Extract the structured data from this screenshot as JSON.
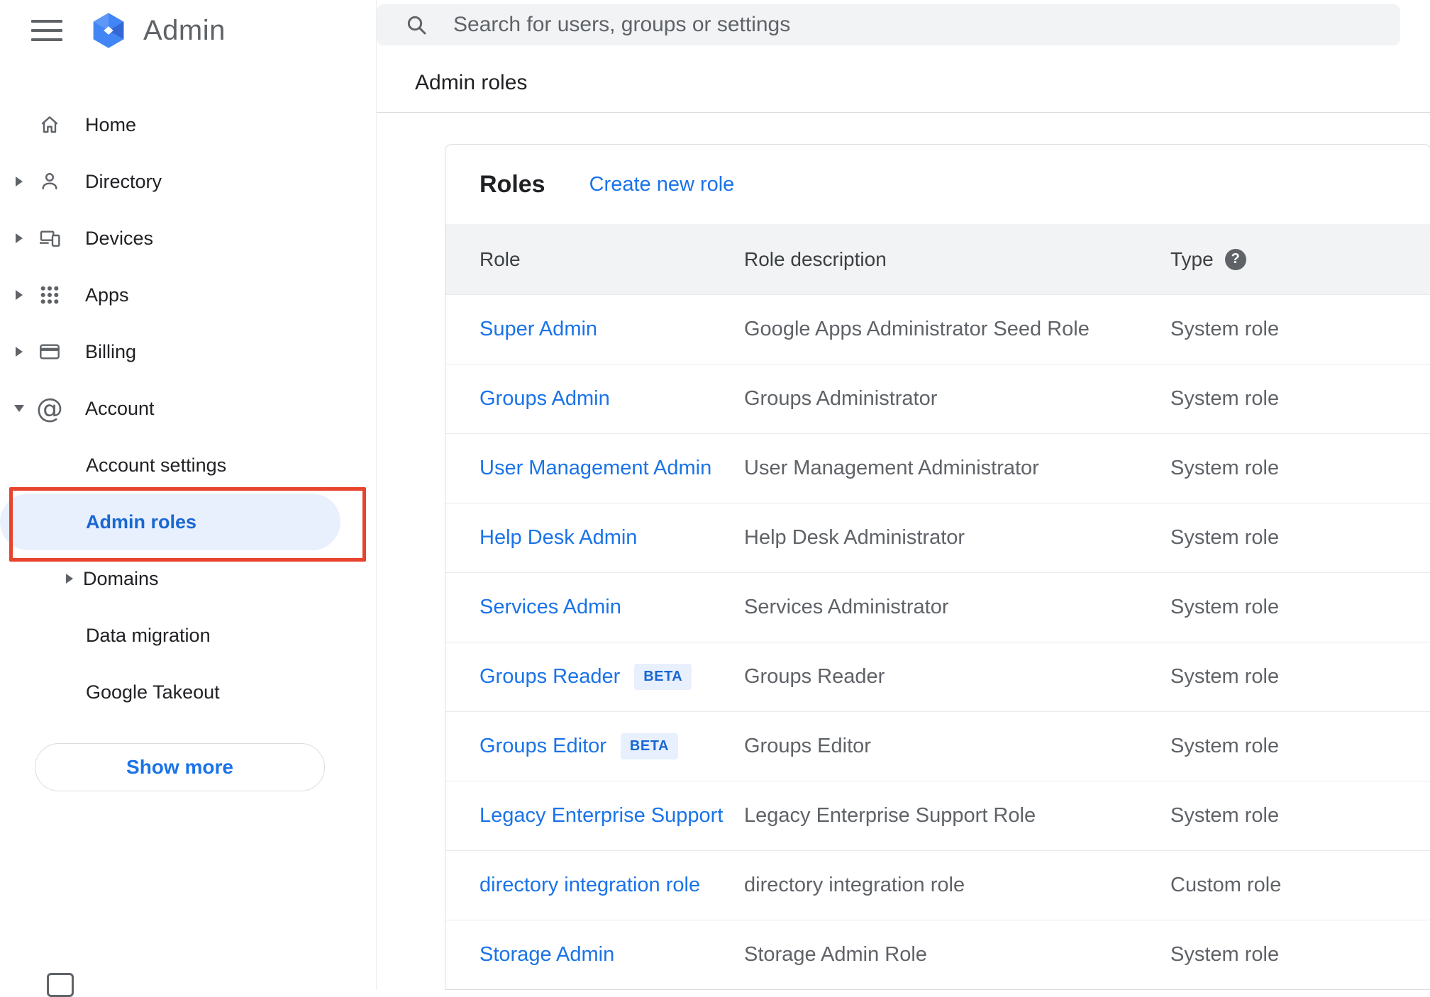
{
  "header": {
    "brand": "Admin"
  },
  "search": {
    "placeholder": "Search for users, groups or settings"
  },
  "breadcrumb": "Admin roles",
  "sidebar": {
    "items": [
      {
        "label": "Home"
      },
      {
        "label": "Directory"
      },
      {
        "label": "Devices"
      },
      {
        "label": "Apps"
      },
      {
        "label": "Billing"
      },
      {
        "label": "Account"
      }
    ],
    "account_children": [
      {
        "label": "Account settings"
      },
      {
        "label": "Admin roles"
      },
      {
        "label": "Domains"
      },
      {
        "label": "Data migration"
      },
      {
        "label": "Google Takeout"
      }
    ],
    "show_more_label": "Show more"
  },
  "roles_card": {
    "title": "Roles",
    "create_link": "Create new role",
    "columns": [
      "Role",
      "Role description",
      "Type"
    ],
    "rows": [
      {
        "role": "Super Admin",
        "badge": "",
        "description": "Google Apps Administrator Seed Role",
        "type": "System role"
      },
      {
        "role": "Groups Admin",
        "badge": "",
        "description": "Groups Administrator",
        "type": "System role"
      },
      {
        "role": "User Management Admin",
        "badge": "",
        "description": "User Management Administrator",
        "type": "System role"
      },
      {
        "role": "Help Desk Admin",
        "badge": "",
        "description": "Help Desk Administrator",
        "type": "System role"
      },
      {
        "role": "Services Admin",
        "badge": "",
        "description": "Services Administrator",
        "type": "System role"
      },
      {
        "role": "Groups Reader",
        "badge": "BETA",
        "description": "Groups Reader",
        "type": "System role"
      },
      {
        "role": "Groups Editor",
        "badge": "BETA",
        "description": "Groups Editor",
        "type": "System role"
      },
      {
        "role": "Legacy Enterprise Support",
        "badge": "",
        "description": "Legacy Enterprise Support Role",
        "type": "System role"
      },
      {
        "role": "directory integration role",
        "badge": "",
        "description": "directory integration role",
        "type": "Custom role"
      },
      {
        "role": "Storage Admin",
        "badge": "",
        "description": "Storage Admin Role",
        "type": "System role"
      }
    ]
  },
  "colors": {
    "accent_blue": "#1a73e8",
    "active_blue": "#1967d2",
    "active_pill_bg": "#e8f0fe",
    "annotation_red": "#e8432c",
    "header_row_bg": "#f1f3f4",
    "search_bg": "#f1f3f4",
    "text_primary": "#202124",
    "text_secondary": "#5f6368",
    "divider": "#dadce0",
    "badge_bg": "#e8f0fe",
    "badge_text": "#1967d2",
    "logo_blue": "#4285f4"
  }
}
